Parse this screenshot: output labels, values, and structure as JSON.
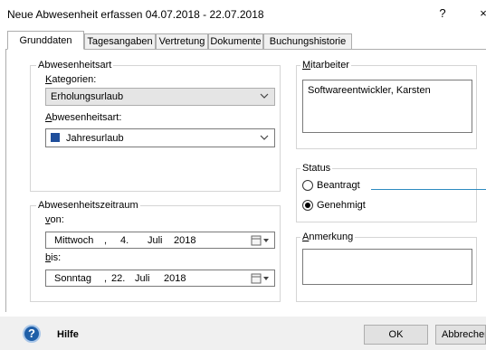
{
  "window": {
    "title": "Neue Abwesenheit erfassen 04.07.2018 - 22.07.2018",
    "help_glyph": "?",
    "close_glyph": "×"
  },
  "tabs": [
    {
      "label": "Grunddaten",
      "active": true
    },
    {
      "label": "Tagesangaben",
      "active": false
    },
    {
      "label": "Vertretung",
      "active": false
    },
    {
      "label": "Dokumente",
      "active": false
    },
    {
      "label": "Buchungshistorie",
      "active": false
    }
  ],
  "abwesenheitsart": {
    "group_label": "Abwesenheitsart",
    "kategorien_label_first": "K",
    "kategorien_label_rest": "ategorien:",
    "kategorien_value": "Erholungsurlaub",
    "art_label_first": "A",
    "art_label_rest": "bwesenheitsart:",
    "art_value": "Jahresurlaub",
    "art_color": "#1f4e9b"
  },
  "zeitraum": {
    "group_label": "Abwesenheitszeitraum",
    "von_label_first": "v",
    "von_label_rest": "on:",
    "von": {
      "weekday": "Mittwoch",
      "sep1": ",",
      "day": "4.",
      "month": "Juli",
      "year": "2018"
    },
    "bis_label_first": "b",
    "bis_label_rest": "is:",
    "bis": {
      "weekday": "Sonntag",
      "sep1": ",",
      "day": "22.",
      "month": "Juli",
      "year": "2018"
    }
  },
  "mitarbeiter": {
    "group_label_first": "M",
    "group_label_rest": "itarbeiter",
    "value": "Softwareentwickler, Karsten"
  },
  "status": {
    "group_label": "Status",
    "options": [
      {
        "label": "Beantragt",
        "selected": false
      },
      {
        "label": "Genehmigt",
        "selected": true
      }
    ]
  },
  "anmerkung": {
    "group_label_first": "A",
    "group_label_rest": "nmerkung",
    "value": ""
  },
  "footer": {
    "help_glyph": "?",
    "help_label": "Hilfe",
    "ok_label": "OK",
    "cancel_label": "Abbrechen"
  },
  "colors": {
    "callout_line": "#2e8bc0",
    "help_icon": "#1f5fa8"
  }
}
